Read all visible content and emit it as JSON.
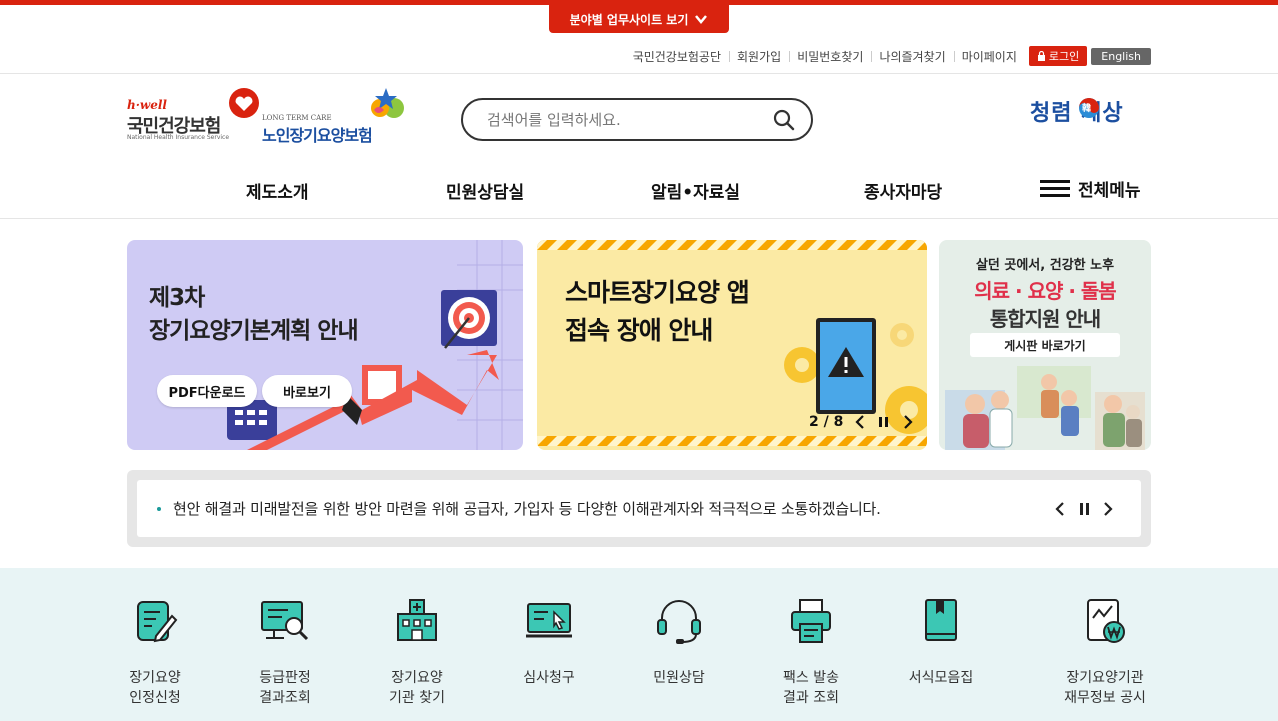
{
  "top": {
    "field_sites_label": "분야별 업무사이트 보기",
    "utility_links": [
      "국민건강보험공단",
      "회원가입",
      "비밀번호찾기",
      "나의즐겨찾기",
      "마이페이지"
    ],
    "login_label": "로그인",
    "english_label": "English"
  },
  "header": {
    "nhis_logo": {
      "slogan": "h·well",
      "name": "국민건강보험",
      "sub": "National Health Insurance Service"
    },
    "ltc_logo": {
      "sub": "LONG TERM CARE",
      "name": "노인장기요양보험"
    },
    "search_placeholder": "검색어를 입력하세요.",
    "clean_logo_text": "청렴 세상",
    "clean_logo_badge": "韓"
  },
  "gnb": {
    "items": [
      "제도소개",
      "민원상담실",
      "알림•자료실",
      "종사자마당"
    ],
    "all_menu_label": "전체메뉴"
  },
  "banners": {
    "b1": {
      "title_line1": "제3차",
      "title_line2": "장기요양기본계획 안내",
      "btn_pdf": "PDF다운로드",
      "btn_view": "바로보기"
    },
    "b2": {
      "title_line1": "스마트장기요양 앱",
      "title_line2": "접속 장애 안내",
      "page": "2 / 8"
    },
    "b3": {
      "line1": "살던 곳에서, 건강한 노후",
      "line2": "의료 · 요양 · 돌봄",
      "line3": "통합지원 안내",
      "btn": "게시판 바로가기"
    }
  },
  "notice": {
    "text": "현안 해결과 미래발전을 위한 방안 마련을 위해 공급자, 가입자 등 다양한 이해관계자와 적극적으로 소통하겠습니다."
  },
  "quick_menu": [
    {
      "label": "장기요양\n인정신청",
      "icon": "application-form-icon"
    },
    {
      "label": "등급판정\n결과조회",
      "icon": "grade-search-icon"
    },
    {
      "label": "장기요양\n기관 찾기",
      "icon": "hospital-icon"
    },
    {
      "label": "심사청구",
      "icon": "monitor-click-icon"
    },
    {
      "label": "민원상담",
      "icon": "headset-icon"
    },
    {
      "label": "팩스 발송\n결과 조회",
      "icon": "fax-icon"
    },
    {
      "label": "서식모음집",
      "icon": "form-book-icon"
    },
    {
      "label": "장기요양기관\n재무정보 공시",
      "icon": "financial-report-icon"
    }
  ],
  "colors": {
    "brand_red": "#d9230f",
    "teal": "#1a9a9a",
    "quick_bg": "#e8f4f5"
  }
}
